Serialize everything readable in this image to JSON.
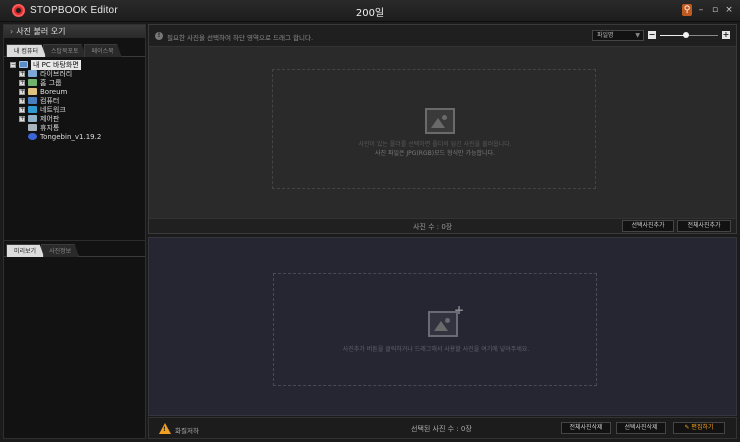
{
  "app": {
    "name": "STOPBOOK Editor",
    "window_title": "200일"
  },
  "window_controls": {
    "pin": "⚲",
    "minimize": "–",
    "restore": "▫",
    "close": "×"
  },
  "left_panel": {
    "header": "사진 불러 오기",
    "tabs": [
      "내 컴퓨터",
      "스탑북포토",
      "페이스북"
    ],
    "tree": {
      "root": "내 PC 바탕화면",
      "items": [
        "라이브러리",
        "홈 그룹",
        "Boreum",
        "컴퓨터",
        "네트워크",
        "제어판",
        "휴지통",
        "Tongebin_v1.19.2"
      ]
    },
    "bottom_tabs": [
      "미리보기",
      "사진정보"
    ]
  },
  "upper": {
    "info_icon": "!",
    "info_text": "필요한 사진을 선택하여 하단 영역으로 드래그 합니다.",
    "sort_value": "파일명",
    "zoom": {
      "minus": "−",
      "plus": "+",
      "level": 0.45
    },
    "drop_text_1": "사진이 있는 폴더를 선택하면 폴더의 담긴 사진을 불러옵니다.",
    "drop_text_2": "사진 파일은 JPG(RGB)모드 형식만 가능합니다.",
    "photo_count": "사진 수 : 0장",
    "btn_add_selected": "선택사진추가",
    "btn_add_all": "전체사진추가"
  },
  "lower": {
    "drop_text": "사진추가 버튼을 클릭하거나 드래그해서 사용할 사진을 여기에 넣어주세요."
  },
  "status": {
    "warn_text": "화질저하",
    "selected_count": "선택된 사진 수 : 0장",
    "btn_delete_all": "전체사진삭제",
    "btn_delete_selected": "선택사진삭제",
    "btn_edit": "편집하기"
  }
}
